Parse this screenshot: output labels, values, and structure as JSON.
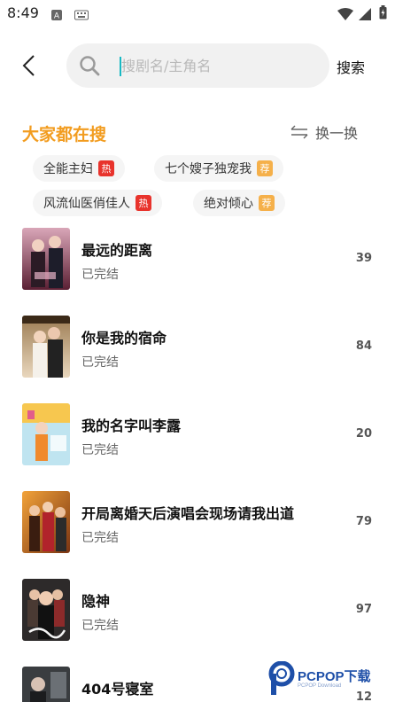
{
  "status_bar": {
    "time": "8:49"
  },
  "search": {
    "placeholder": "搜剧名/主角名",
    "value": "",
    "button_label": "搜索"
  },
  "hot": {
    "title": "大家都在搜",
    "refresh_label": "换一换",
    "chips": [
      {
        "label": "全能主妇",
        "badge": "热",
        "badge_color": "#e8332c"
      },
      {
        "label": "七个嫂子独宠我",
        "badge": "荐",
        "badge_color": "#f5b04a"
      },
      {
        "label": "风流仙医俏佳人",
        "badge": "热",
        "badge_color": "#e8332c"
      },
      {
        "label": "绝对倾心",
        "badge": "荐",
        "badge_color": "#f5b04a"
      }
    ]
  },
  "results": [
    {
      "title": "最远的距离",
      "status": "已完结",
      "count": "39"
    },
    {
      "title": "你是我的宿命",
      "status": "已完结",
      "count": "84"
    },
    {
      "title": "我的名字叫李露",
      "status": "已完结",
      "count": "20"
    },
    {
      "title": "开局离婚天后演唱会现场请我出道",
      "status": "已完结",
      "count": "79"
    },
    {
      "title": "隐神",
      "status": "已完结",
      "count": "97"
    },
    {
      "title": "404号寝室",
      "status": "",
      "count": "12"
    }
  ],
  "watermark": {
    "text": "PCPOP下载",
    "sub": "PCPOP Download"
  },
  "colors": {
    "accent": "#f29c1f",
    "caret": "#17b9c3",
    "hot_badge": "#e8332c",
    "rec_badge": "#f5b04a"
  }
}
